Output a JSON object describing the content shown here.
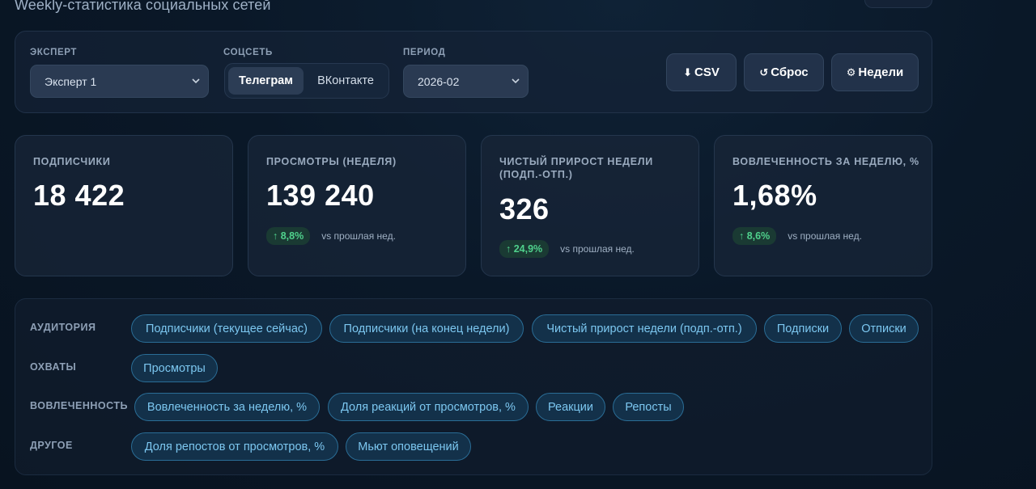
{
  "page": {
    "title": "Weekly-статистика социальных сетей"
  },
  "filters": {
    "expert": {
      "label": "ЭКСПЕРТ",
      "value": "Эксперт 1"
    },
    "network": {
      "label": "СОЦСЕТЬ",
      "options": [
        "Телеграм",
        "ВКонтакте"
      ],
      "active": "Телеграм"
    },
    "period": {
      "label": "ПЕРИОД",
      "value": "2026-02"
    },
    "actions": [
      {
        "icon": "download-icon",
        "glyph": "⬇",
        "label": "CSV"
      },
      {
        "icon": "reset-icon",
        "glyph": "↺",
        "label": "Сброс"
      },
      {
        "icon": "gear-icon",
        "glyph": "⚙",
        "label": "Недели"
      }
    ]
  },
  "cards": [
    {
      "label": "ПОДПИСЧИКИ",
      "value": "18 422"
    },
    {
      "label": "ПРОСМОТРЫ (НЕДЕЛЯ)",
      "value": "139 240",
      "delta": "↑ 8,8%",
      "vs": "vs прошлая нед."
    },
    {
      "label": "ЧИСТЫЙ ПРИРОСТ НЕДЕЛИ (ПОДП.-ОТП.)",
      "value": "326",
      "delta": "↑ 24,9%",
      "vs": "vs прошлая нед."
    },
    {
      "label": "ВОВЛЕЧЕННОСТЬ ЗА НЕДЕЛЮ, %",
      "value": "1,68%",
      "delta": "↑ 8,6%",
      "vs": "vs прошлая нед."
    }
  ],
  "metric_groups": [
    {
      "label": "АУДИТОРИЯ",
      "chips": [
        "Подписчики (текущее сейчас)",
        "Подписчики (на конец недели)",
        "Чистый прирост недели (подп.-отп.)",
        "Подписки",
        "Отписки"
      ]
    },
    {
      "label": "ОХВАТЫ",
      "chips": [
        "Просмотры"
      ]
    },
    {
      "label": "ВОВЛЕЧЕННОСТЬ",
      "chips": [
        "Вовлеченность за неделю, %",
        "Доля реакций от просмотров, %",
        "Реакции",
        "Репосты"
      ]
    },
    {
      "label": "ДРУГОЕ",
      "chips": [
        "Доля репостов от просмотров, %",
        "Мьют оповещений"
      ]
    }
  ],
  "colors": {
    "background": "#0a1828",
    "accent_chip": "#7cc7f0",
    "positive": "#4fd18c"
  }
}
